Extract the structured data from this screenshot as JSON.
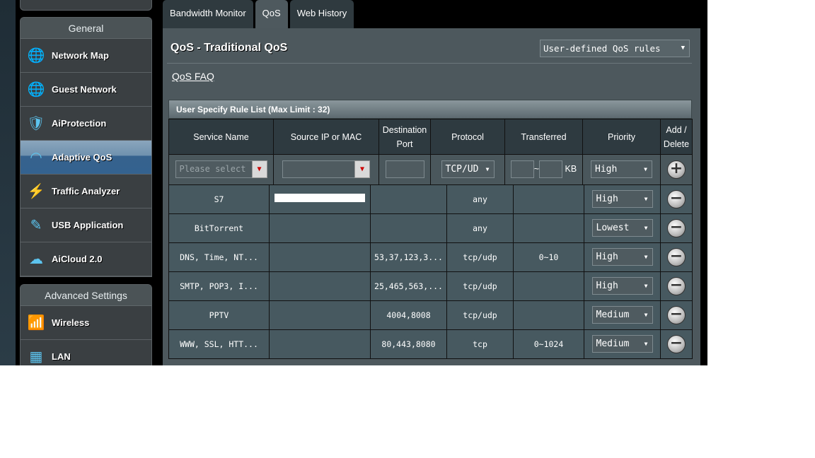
{
  "tabs": [
    "Bandwidth Monitor",
    "QoS",
    "Web History"
  ],
  "sidebar": {
    "general_title": "General",
    "items": [
      {
        "label": "Network Map",
        "icon": "globe-pin-icon"
      },
      {
        "label": "Guest Network",
        "icon": "globe-users-icon"
      },
      {
        "label": "AiProtection",
        "icon": "shield-lock-icon"
      },
      {
        "label": "Adaptive QoS",
        "icon": "speedometer-icon"
      },
      {
        "label": "Traffic Analyzer",
        "icon": "traffic-icon"
      },
      {
        "label": "USB Application",
        "icon": "usb-icon"
      },
      {
        "label": "AiCloud 2.0",
        "icon": "cloud-icon"
      }
    ],
    "advanced_title": "Advanced Settings",
    "advanced_items": [
      {
        "label": "Wireless",
        "icon": "wireless-icon"
      },
      {
        "label": "LAN",
        "icon": "lan-icon"
      }
    ]
  },
  "main": {
    "title": "QoS - Traditional QoS",
    "mode_select": "User-defined QoS rules",
    "faq": "QoS FAQ",
    "table_title": "User Specify Rule List (Max Limit : 32)",
    "columns": [
      "Service Name",
      "Source IP or MAC",
      "Destination Port",
      "Protocol",
      "Transferred",
      "Priority",
      "Add / Delete"
    ],
    "input_row": {
      "service_placeholder": "Please select",
      "protocol": "TCP/UD",
      "tilde": "~",
      "unit": "KB",
      "priority": "High"
    },
    "rows": [
      {
        "service": "S7",
        "source": "",
        "port": "",
        "protocol": "any",
        "transferred": "",
        "priority": "High"
      },
      {
        "service": "BitTorrent",
        "source": "",
        "port": "",
        "protocol": "any",
        "transferred": "",
        "priority": "Lowest"
      },
      {
        "service": "DNS, Time, NT...",
        "source": "",
        "port": "53,37,123,3...",
        "protocol": "tcp/udp",
        "transferred": "0~10",
        "priority": "High"
      },
      {
        "service": "SMTP, POP3, I...",
        "source": "",
        "port": "25,465,563,...",
        "protocol": "tcp/udp",
        "transferred": "",
        "priority": "High"
      },
      {
        "service": "PPTV",
        "source": "",
        "port": "4004,8008",
        "protocol": "tcp/udp",
        "transferred": "",
        "priority": "Medium"
      },
      {
        "service": "WWW, SSL, HTT...",
        "source": "",
        "port": "80,443,8080",
        "protocol": "tcp",
        "transferred": "0~1024",
        "priority": "Medium"
      }
    ]
  }
}
